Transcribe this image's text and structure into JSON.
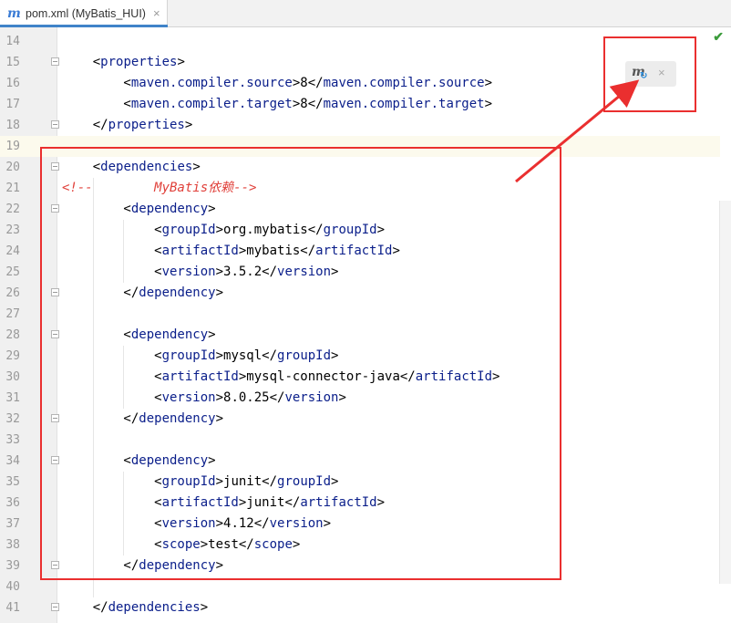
{
  "tab": {
    "file_icon": "maven-file-icon",
    "label": "pom.xml (MyBatis_HUI)",
    "close": "×"
  },
  "editor": {
    "status_icon": "✔",
    "lines": [
      {
        "num": "14",
        "code": ""
      },
      {
        "num": "15",
        "code": "    <properties>"
      },
      {
        "num": "16",
        "code": "        <maven.compiler.source>8</maven.compiler.source>"
      },
      {
        "num": "17",
        "code": "        <maven.compiler.target>8</maven.compiler.target>"
      },
      {
        "num": "18",
        "code": "    </properties>"
      },
      {
        "num": "19",
        "code": ""
      },
      {
        "num": "20",
        "code": "    <dependencies>"
      },
      {
        "num": "21",
        "code": "<!--        MyBatis依赖-->"
      },
      {
        "num": "22",
        "code": "        <dependency>"
      },
      {
        "num": "23",
        "code": "            <groupId>org.mybatis</groupId>"
      },
      {
        "num": "24",
        "code": "            <artifactId>mybatis</artifactId>"
      },
      {
        "num": "25",
        "code": "            <version>3.5.2</version>"
      },
      {
        "num": "26",
        "code": "        </dependency>"
      },
      {
        "num": "27",
        "code": ""
      },
      {
        "num": "28",
        "code": "        <dependency>"
      },
      {
        "num": "29",
        "code": "            <groupId>mysql</groupId>"
      },
      {
        "num": "30",
        "code": "            <artifactId>mysql-connector-java</artifactId>"
      },
      {
        "num": "31",
        "code": "            <version>8.0.25</version>"
      },
      {
        "num": "32",
        "code": "        </dependency>"
      },
      {
        "num": "33",
        "code": ""
      },
      {
        "num": "34",
        "code": "        <dependency>"
      },
      {
        "num": "35",
        "code": "            <groupId>junit</groupId>"
      },
      {
        "num": "36",
        "code": "            <artifactId>junit</artifactId>"
      },
      {
        "num": "37",
        "code": "            <version>4.12</version>"
      },
      {
        "num": "38",
        "code": "            <scope>test</scope>"
      },
      {
        "num": "39",
        "code": "        </dependency>"
      },
      {
        "num": "40",
        "code": ""
      },
      {
        "num": "41",
        "code": "    </dependencies>"
      }
    ]
  },
  "popup": {
    "icon": "maven-reload-icon",
    "close": "×"
  },
  "annotation": {
    "color": "#ea2f2f"
  }
}
